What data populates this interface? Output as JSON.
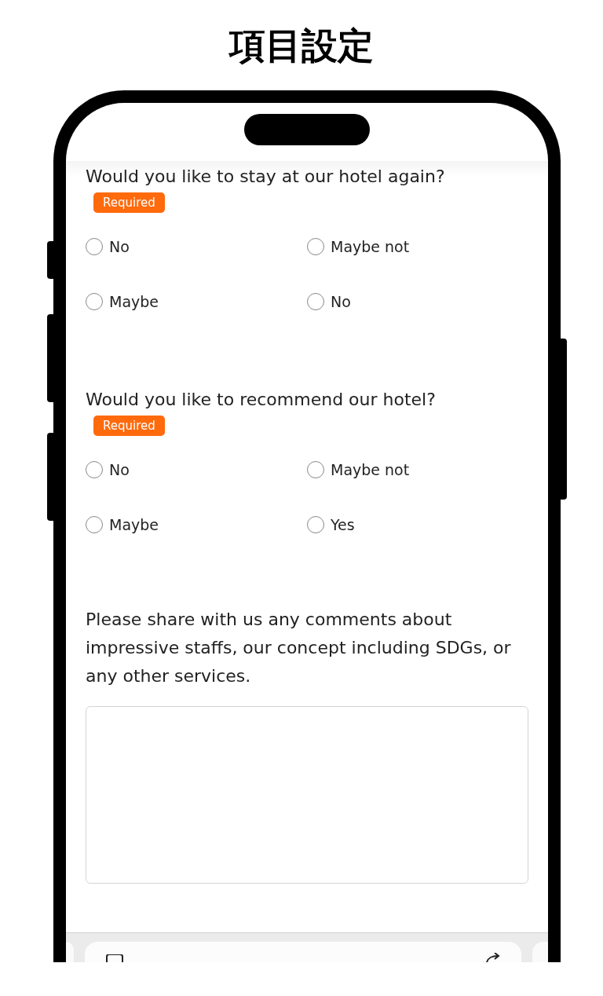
{
  "title": "項目設定",
  "questions": [
    {
      "text": "Would you like to stay at our hotel again?",
      "badge": "Required",
      "options": [
        {
          "label": "No",
          "selected": false
        },
        {
          "label": "Maybe not",
          "selected": false
        },
        {
          "label": "Maybe",
          "selected": false
        },
        {
          "label": "No",
          "selected": false
        }
      ]
    },
    {
      "text": "Would you like to recommend our hotel?",
      "badge": "Required",
      "options": [
        {
          "label": "No",
          "selected": false
        },
        {
          "label": "Maybe not",
          "selected": false
        },
        {
          "label": "Maybe",
          "selected": false
        },
        {
          "label": "Yes",
          "selected": false
        }
      ]
    }
  ],
  "comment": {
    "prompt": "Please share with us any comments about impressive staffs, our concept including SDGs, or any other services."
  }
}
